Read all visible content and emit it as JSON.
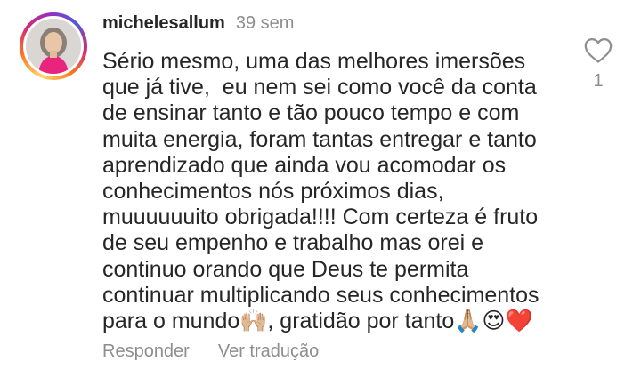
{
  "comment": {
    "username": "michelesallum",
    "time": "39 sem",
    "lines": [
      "Sério mesmo, uma das melhores imersões",
      "que já tive,  eu nem sei como você da conta",
      "de ensinar tanto e tão pouco tempo e com",
      "muita energia, foram tantas entregar e tanto",
      "aprendizado que ainda vou acomodar os",
      "conhecimentos nós próximos dias,",
      "muuuuuuito obrigada!!!! Com certeza é fruto",
      "de seu empenho e trabalho mas orei e",
      "continuo orando que Deus te permita",
      "continuar multiplicando seus conhecimentos",
      "para o mundo🙌🏼, gratidão por tanto🙏🏼😍❤️"
    ],
    "like_icon": "heart-outline-icon",
    "like_count": "1"
  },
  "actions": {
    "reply": "Responder",
    "translate": "Ver tradução"
  },
  "colors": {
    "text": "#262626",
    "muted": "#8e8e8e",
    "avatar_shirt": "#e8247c"
  }
}
